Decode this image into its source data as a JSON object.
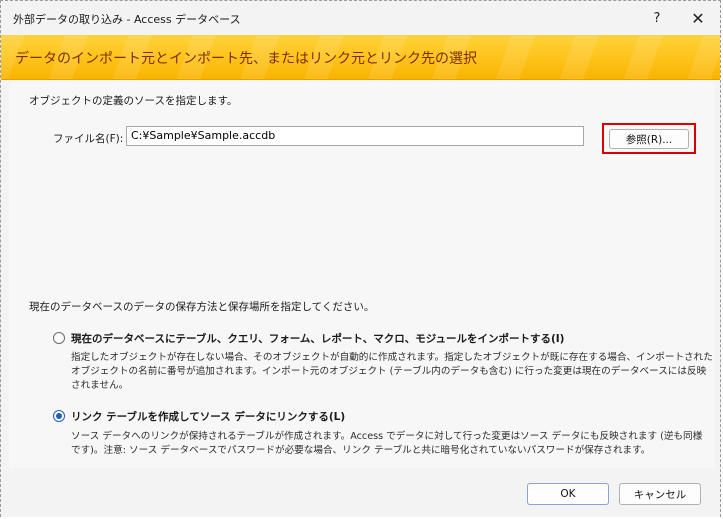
{
  "window": {
    "title": "外部データの取り込み - Access データベース",
    "help_glyph": "?",
    "close_glyph": "✕"
  },
  "banner": {
    "text": "データのインポート元とインポート先、またはリンク元とリンク先の選択"
  },
  "source": {
    "instruction": "オブジェクトの定義のソースを指定します。",
    "file_label": "ファイル名(F):",
    "file_value": "C:¥Sample¥Sample.accdb",
    "browse_label": "参照(R)..."
  },
  "storage": {
    "instruction": "現在のデータベースのデータの保存方法と保存場所を指定してください。",
    "options": [
      {
        "label": "現在のデータベースにテーブル、クエリ、フォーム、レポート、マクロ、モジュールをインポートする(I)",
        "selected": false,
        "description": [
          "指定したオブジェクトが存在しない場合、そのオブジェクトが自動的に作成されます。指定したオブジェクトが既に存在する場合、インポートされた",
          "オブジェクトの名前に番号が追加されます。インポート元のオブジェクト (テーブル内のデータも含む) に行った変更は現在のデータベースには反映",
          "されません。"
        ]
      },
      {
        "label": "リンク テーブルを作成してソース データにリンクする(L)",
        "selected": true,
        "description": [
          "ソース データへのリンクが保持されるテーブルが作成されます。Access でデータに対して行った変更はソース データにも反映されます (逆も同様",
          "です)。注意: ソース データベースでパスワードが必要な場合、リンク テーブルと共に暗号化されていないパスワードが保存されます。"
        ]
      }
    ]
  },
  "footer": {
    "ok_label": "OK",
    "cancel_label": "キャンセル"
  },
  "colors": {
    "banner": "#ffc21a",
    "banner_text": "#7a2e00",
    "highlight": "#d80000",
    "radio_selected": "#1f5ebd"
  }
}
